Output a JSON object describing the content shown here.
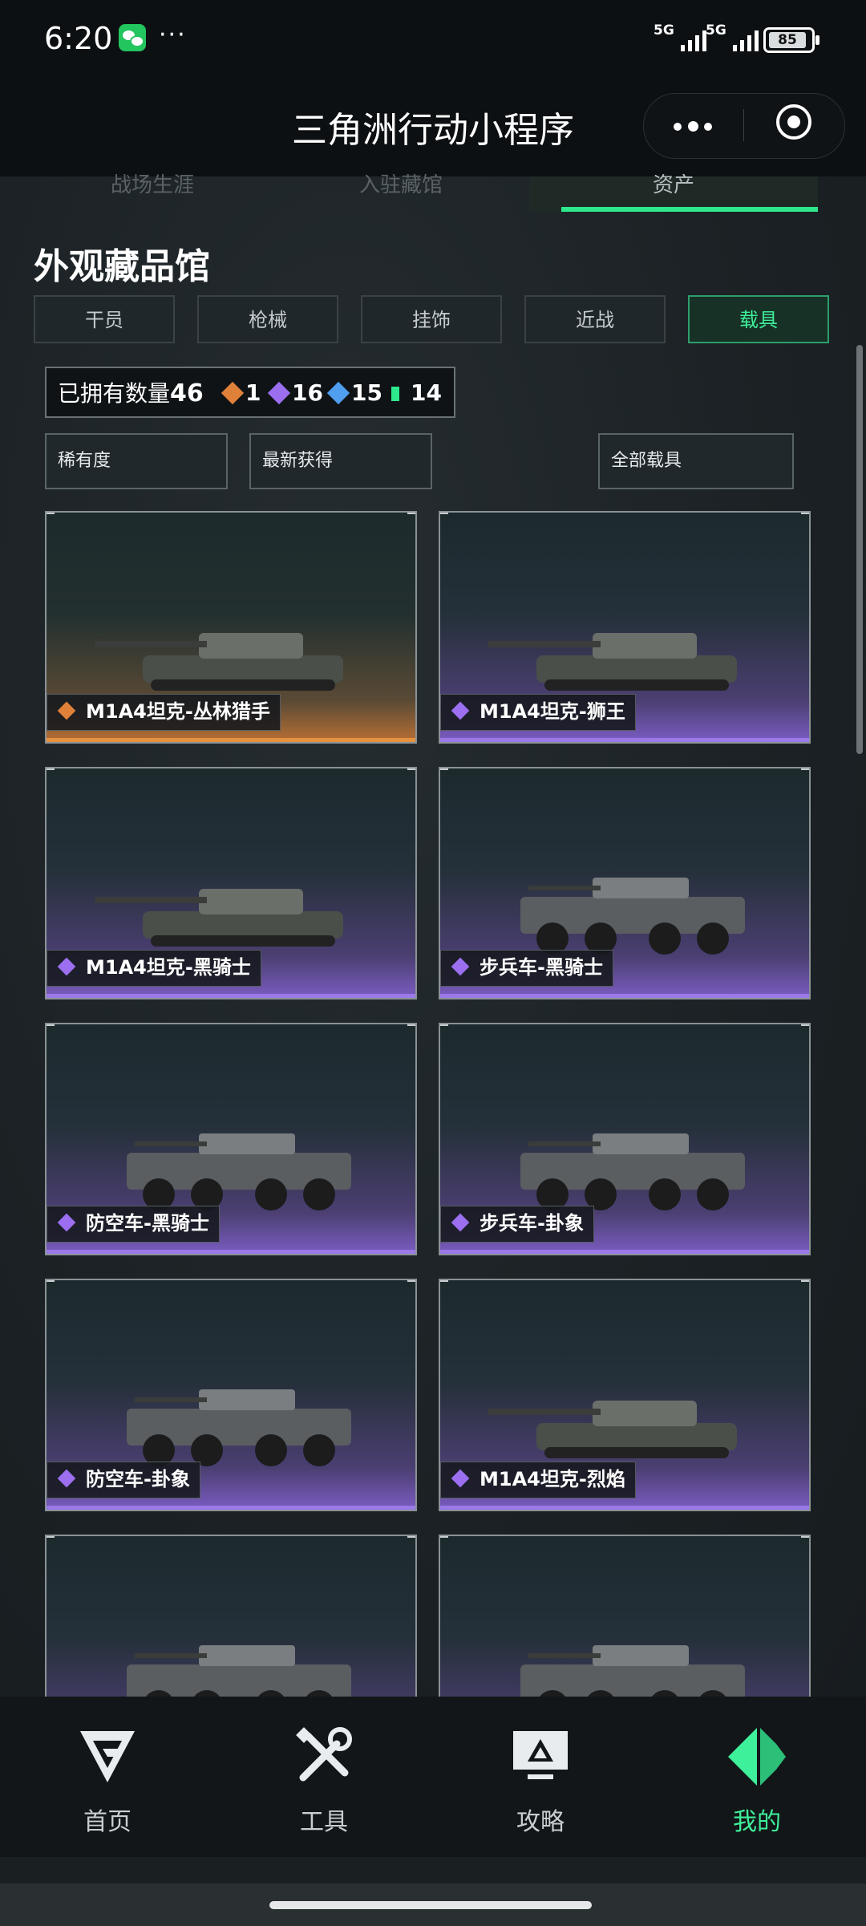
{
  "status_bar": {
    "time": "6:20",
    "dots": "···",
    "network1": "5G",
    "network2": "5G",
    "battery": "85"
  },
  "header": {
    "title": "三角洲行动小程序"
  },
  "top_tabs": [
    "战场生涯",
    "入驻藏馆",
    "资产"
  ],
  "section": {
    "title": "外观藏品馆"
  },
  "categories": [
    {
      "label": "干员",
      "active": false
    },
    {
      "label": "枪械",
      "active": false
    },
    {
      "label": "挂饰",
      "active": false
    },
    {
      "label": "近战",
      "active": false
    },
    {
      "label": "载具",
      "active": true
    }
  ],
  "owned": {
    "label": "已拥有数量",
    "total": "46",
    "counts": [
      {
        "value": "1",
        "color": "#e0813a"
      },
      {
        "value": "16",
        "color": "#9b6ff0"
      },
      {
        "value": "15",
        "color": "#4f9ef0"
      },
      {
        "value": "14",
        "color": "#2ee88c"
      }
    ]
  },
  "filters": {
    "rarity": "稀有度",
    "sort": "最新获得",
    "type": "全部载具"
  },
  "cards": [
    {
      "name": "M1A4坦克-丛林猎手",
      "rarity": "gold"
    },
    {
      "name": "M1A4坦克-狮王",
      "rarity": "purple"
    },
    {
      "name": "M1A4坦克-黑骑士",
      "rarity": "purple"
    },
    {
      "name": "步兵车-黑骑士",
      "rarity": "purple"
    },
    {
      "name": "防空车-黑骑士",
      "rarity": "purple"
    },
    {
      "name": "步兵车-卦象",
      "rarity": "purple"
    },
    {
      "name": "防空车-卦象",
      "rarity": "purple"
    },
    {
      "name": "M1A4坦克-烈焰",
      "rarity": "purple"
    },
    {
      "name": "",
      "rarity": "purple"
    },
    {
      "name": "",
      "rarity": "purple"
    }
  ],
  "bottom_nav": [
    {
      "label": "首页",
      "icon": "home-logo-icon",
      "active": false
    },
    {
      "label": "工具",
      "icon": "tools-icon",
      "active": false
    },
    {
      "label": "攻略",
      "icon": "guide-monitor-icon",
      "active": false
    },
    {
      "label": "我的",
      "icon": "profile-logo-icon",
      "active": true
    }
  ],
  "colors": {
    "accent": "#3ff09a",
    "gold": "#e59240",
    "purple": "#9a79e8"
  }
}
